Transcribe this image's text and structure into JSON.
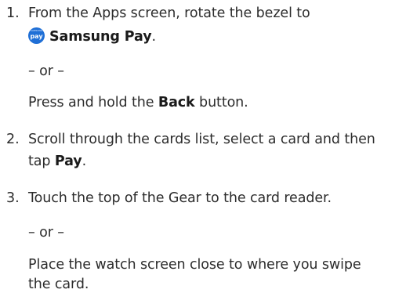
{
  "step1": {
    "number": "1.",
    "line1": "From the Apps screen, rotate the bezel to",
    "icon_label": "pay",
    "icon_brand": "SAMSUNG",
    "app_name": "Samsung Pay",
    "period": ".",
    "or": "– or –",
    "alt_prefix": "Press and hold the ",
    "alt_bold": "Back",
    "alt_suffix": " button."
  },
  "step2": {
    "number": "2.",
    "line1": "Scroll through the cards list, select a card and then",
    "line2_prefix": "tap ",
    "line2_bold": "Pay",
    "line2_suffix": "."
  },
  "step3": {
    "number": "3.",
    "line1": "Touch the top of the Gear to the card reader.",
    "or": "– or –",
    "alt_line1": "Place the watch screen close to where you swipe",
    "alt_line2": "the card."
  },
  "colors": {
    "icon_bg": "#1f6fd6",
    "text": "#2c2c2c"
  }
}
